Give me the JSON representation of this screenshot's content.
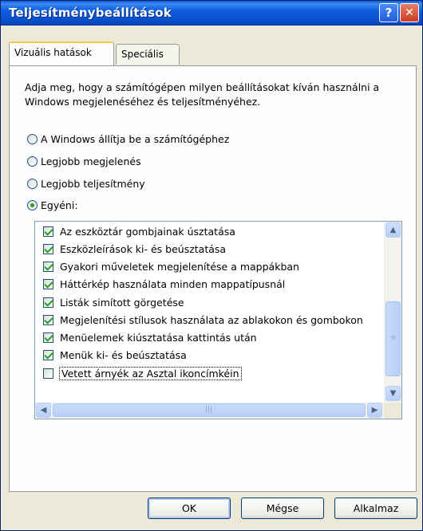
{
  "window": {
    "title": "Teljesítménybeállítások"
  },
  "titlebar": {
    "help_label": "?",
    "close_label": "✕"
  },
  "tabs": [
    {
      "label": "Vizuális hatások",
      "active": true
    },
    {
      "label": "Speciális",
      "active": false
    }
  ],
  "description": "Adja meg, hogy a számítógépen milyen beállításokat kíván használni a Windows megjelenéséhez és teljesítményéhez.",
  "radios": [
    {
      "label": "A Windows állítja be a számítógéphez",
      "checked": false
    },
    {
      "label": "Legjobb megjelenés",
      "checked": false
    },
    {
      "label": "Legjobb teljesítmény",
      "checked": false
    },
    {
      "label": "Egyéni:",
      "checked": true
    }
  ],
  "options": [
    {
      "label": "Az eszköztár gombjainak úsztatása",
      "checked": true
    },
    {
      "label": "Eszközleírások ki- és beúsztatása",
      "checked": true
    },
    {
      "label": "Gyakori műveletek megjelenítése a mappákban",
      "checked": true
    },
    {
      "label": "Háttérkép használata minden mappatípusnál",
      "checked": true
    },
    {
      "label": "Listák simított görgetése",
      "checked": true
    },
    {
      "label": "Megjelenítési stílusok használata az ablakokon és gombokon",
      "checked": true
    },
    {
      "label": "Menüelemek kiúsztatása kattintás után",
      "checked": true
    },
    {
      "label": "Menük ki- és beúsztatása",
      "checked": true
    },
    {
      "label": "Vetett árnyék az Asztal ikoncímkéin",
      "checked": false,
      "focused": true
    }
  ],
  "buttons": {
    "ok": "OK",
    "cancel": "Mégse",
    "apply": "Alkalmaz"
  },
  "icons": {
    "scroll_up": "scroll-up-arrow-icon",
    "scroll_down": "scroll-down-arrow-icon",
    "scroll_left": "scroll-left-arrow-icon",
    "scroll_right": "scroll-right-arrow-icon"
  },
  "colors": {
    "titlebar": "#0a5bd8",
    "dialog_bg": "#ece9d8",
    "check": "#21a121",
    "focus_tab": "#ffc83c"
  }
}
